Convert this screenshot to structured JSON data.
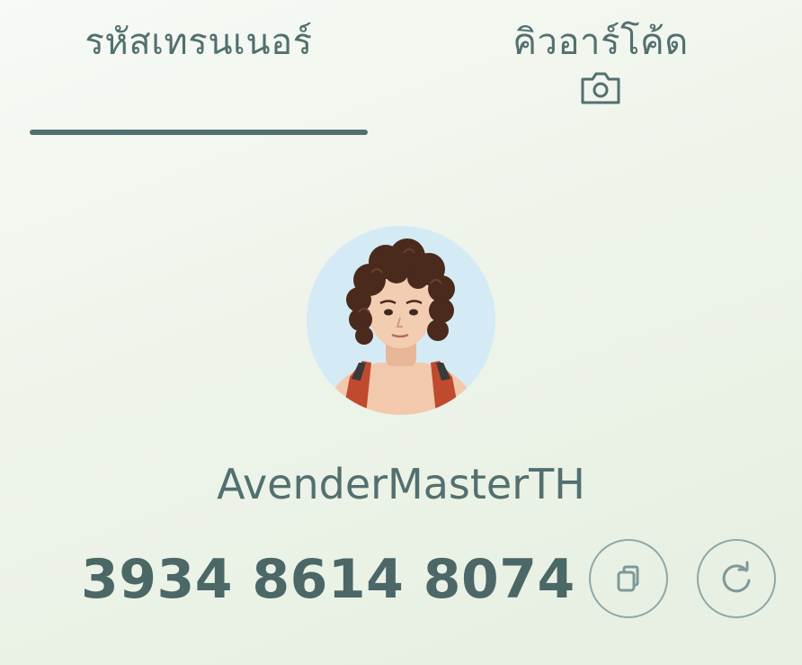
{
  "tabs": {
    "trainer_code": {
      "label": "รหัสเทรนเนอร์",
      "selected": true
    },
    "qr_code": {
      "label": "คิวอาร์โค้ด",
      "icon": "camera-icon"
    }
  },
  "profile": {
    "avatar_icon": "trainer-avatar",
    "username": "AvenderMasterTH",
    "trainer_code": "3934 8614 8074"
  },
  "actions": {
    "copy_icon": "copy-icon",
    "refresh_icon": "refresh-icon"
  },
  "colors": {
    "text": "#52706f",
    "accent": "#4b6766",
    "button_border": "#8fa7a7",
    "avatar_bg": "#d4ebf6"
  }
}
